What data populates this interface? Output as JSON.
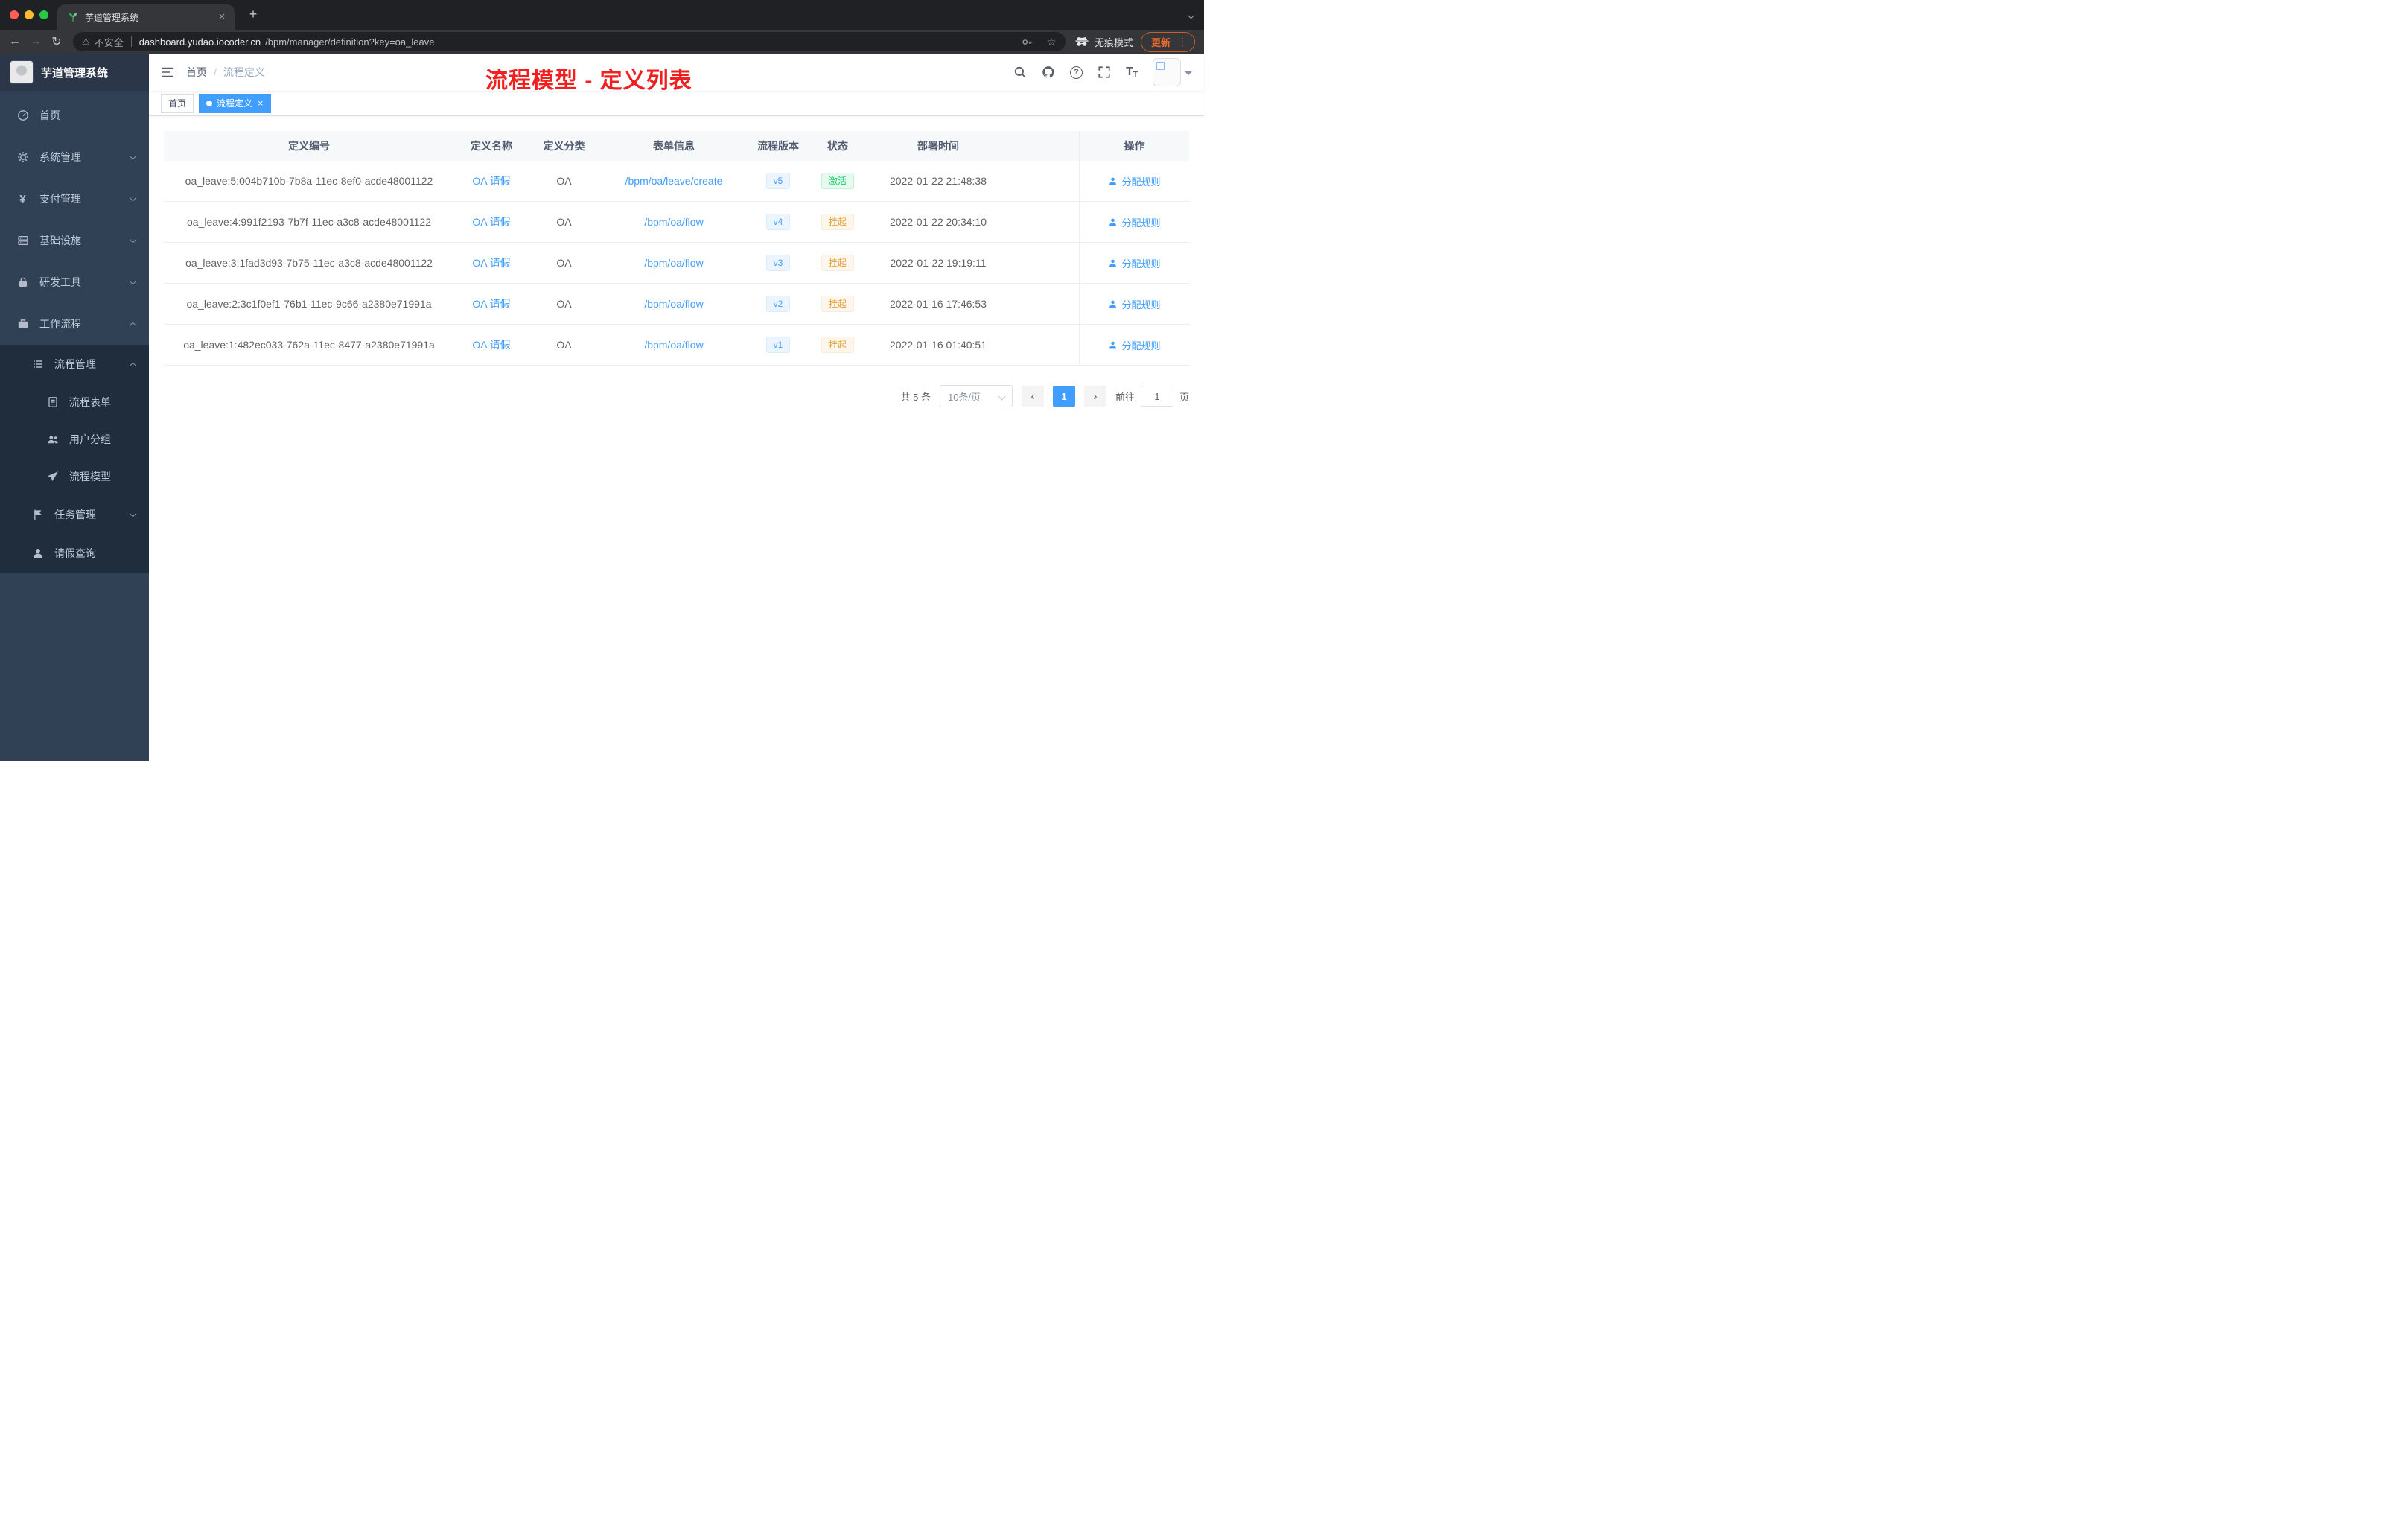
{
  "colors": {
    "accent": "#409eff",
    "status_active": "#13ce66",
    "status_suspended": "#e6a23c",
    "annotation_red": "#f21f1f",
    "sidebar_bg": "#304156",
    "submenu_bg": "#1f2d3d"
  },
  "icons": {
    "close": "×",
    "plus": "+",
    "back": "←",
    "forward": "→",
    "reload": "↻",
    "warning": "⚠",
    "star": "☆",
    "menu_dots": "⋮",
    "question": "?",
    "yen": "¥",
    "breadcrumb_separator": "/",
    "prev": "‹",
    "next": "›",
    "font_size": "T"
  },
  "browser": {
    "tab_title": "芋道管理系统",
    "security_label": "不安全",
    "url_domain": "dashboard.yudao.iocoder.cn",
    "url_path": "/bpm/manager/definition?key=oa_leave",
    "incognito_label": "无痕模式",
    "update_label": "更新"
  },
  "sidebar": {
    "logo_title": "芋道管理系统",
    "items": [
      {
        "label": "首页",
        "icon": "dashboard-icon"
      },
      {
        "label": "系统管理",
        "icon": "gear-icon"
      },
      {
        "label": "支付管理",
        "icon": "yen-icon"
      },
      {
        "label": "基础设施",
        "icon": "server-icon"
      },
      {
        "label": "研发工具",
        "icon": "lock-icon"
      },
      {
        "label": "工作流程",
        "icon": "briefcase-icon"
      },
      {
        "label": "流程管理",
        "icon": "list-icon"
      },
      {
        "label": "流程表单",
        "icon": "form-icon"
      },
      {
        "label": "用户分组",
        "icon": "users-icon"
      },
      {
        "label": "流程模型",
        "icon": "send-icon"
      },
      {
        "label": "任务管理",
        "icon": "flag-icon"
      },
      {
        "label": "请假查询",
        "icon": "person-icon"
      }
    ]
  },
  "navbar": {
    "breadcrumb": [
      "首页",
      "流程定义"
    ],
    "annotation": "流程模型 - 定义列表"
  },
  "tags": [
    {
      "label": "首页",
      "active": false
    },
    {
      "label": "流程定义",
      "active": true
    }
  ],
  "table": {
    "columns": [
      "定义编号",
      "定义名称",
      "定义分类",
      "表单信息",
      "流程版本",
      "状态",
      "部署时间",
      "操作"
    ],
    "rows": [
      {
        "id": "oa_leave:5:004b710b-7b8a-11ec-8ef0-acde48001122",
        "name": "OA 请假",
        "category": "OA",
        "form": "/bpm/oa/leave/create",
        "version": "v5",
        "status": "激活",
        "status_type": "success",
        "deployed": "2022-01-22 21:48:38",
        "action": "分配规则"
      },
      {
        "id": "oa_leave:4:991f2193-7b7f-11ec-a3c8-acde48001122",
        "name": "OA 请假",
        "category": "OA",
        "form": "/bpm/oa/flow",
        "version": "v4",
        "status": "挂起",
        "status_type": "warning",
        "deployed": "2022-01-22 20:34:10",
        "action": "分配规则"
      },
      {
        "id": "oa_leave:3:1fad3d93-7b75-11ec-a3c8-acde48001122",
        "name": "OA 请假",
        "category": "OA",
        "form": "/bpm/oa/flow",
        "version": "v3",
        "status": "挂起",
        "status_type": "warning",
        "deployed": "2022-01-22 19:19:11",
        "action": "分配规则"
      },
      {
        "id": "oa_leave:2:3c1f0ef1-76b1-11ec-9c66-a2380e71991a",
        "name": "OA 请假",
        "category": "OA",
        "form": "/bpm/oa/flow",
        "version": "v2",
        "status": "挂起",
        "status_type": "warning",
        "deployed": "2022-01-16 17:46:53",
        "action": "分配规则"
      },
      {
        "id": "oa_leave:1:482ec033-762a-11ec-8477-a2380e71991a",
        "name": "OA 请假",
        "category": "OA",
        "form": "/bpm/oa/flow",
        "version": "v1",
        "status": "挂起",
        "status_type": "warning",
        "deployed": "2022-01-16 01:40:51",
        "action": "分配规则"
      }
    ]
  },
  "pagination": {
    "total": "共 5 条",
    "page_size": "10条/页",
    "current_page": "1",
    "goto_label": "前往",
    "goto_value": "1",
    "page_suffix": "页"
  }
}
